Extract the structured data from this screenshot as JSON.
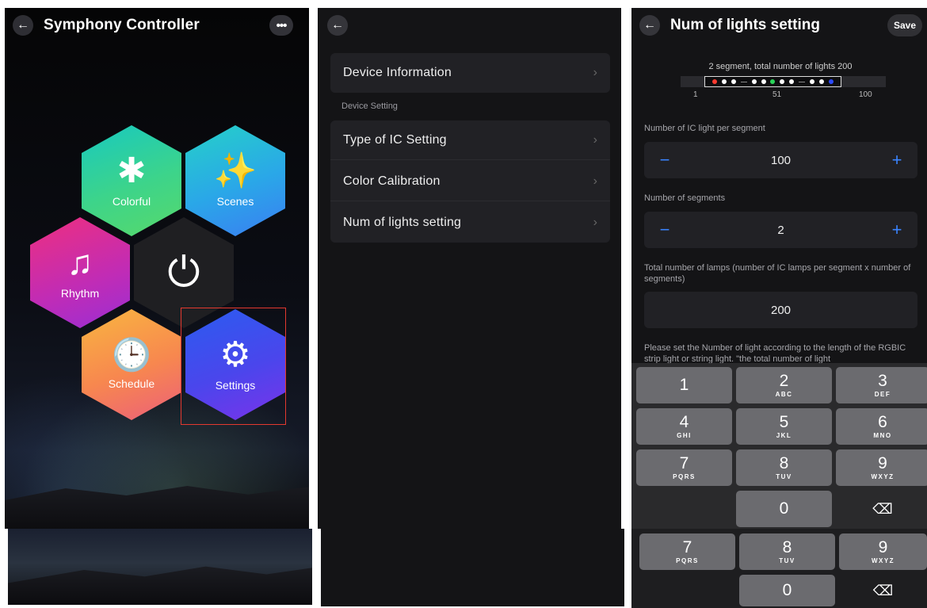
{
  "panel1": {
    "title": "Symphony Controller",
    "back_icon": "←",
    "more_icon": "•••",
    "tiles": {
      "colorful": {
        "label": "Colorful",
        "icon": "✱"
      },
      "scenes": {
        "label": "Scenes",
        "icon": "✨"
      },
      "rhythm": {
        "label": "Rhythm",
        "icon": "♫"
      },
      "power": {
        "icon": "⏻"
      },
      "schedule": {
        "label": "Schedule",
        "icon": "🕒"
      },
      "settings": {
        "label": "Settings",
        "icon": "⚙"
      }
    }
  },
  "panel2": {
    "back_icon": "←",
    "device_information": "Device Information",
    "section_label": "Device Setting",
    "items": [
      "Type of IC Setting",
      "Color Calibration",
      "Num of lights setting"
    ],
    "chevron": "›"
  },
  "panel3": {
    "back_icon": "←",
    "title": "Num of lights setting",
    "save": "Save",
    "segment_caption": "2 segment,  total number of lights 200",
    "ticks": [
      "1",
      "51",
      "100"
    ],
    "ic_per_segment_label": "Number of IC light per segment",
    "ic_per_segment_value": "100",
    "segments_label": "Number of segments",
    "segments_value": "2",
    "total_label": "Total number of lamps (number of IC lamps per segment x number of segments)",
    "total_value": "200",
    "hint": "Please set the Number of light according to the length of the RGBIC strip light or string light. \"the total number of light",
    "minus": "−",
    "plus": "+"
  },
  "keypad": {
    "keys": [
      {
        "n": "1",
        "s": ""
      },
      {
        "n": "2",
        "s": "ABC"
      },
      {
        "n": "3",
        "s": "DEF"
      },
      {
        "n": "4",
        "s": "GHI"
      },
      {
        "n": "5",
        "s": "JKL"
      },
      {
        "n": "6",
        "s": "MNO"
      },
      {
        "n": "7",
        "s": "PQRS"
      },
      {
        "n": "8",
        "s": "TUV"
      },
      {
        "n": "9",
        "s": "WXYZ"
      }
    ],
    "zero": "0",
    "delete_icon": "⌫"
  },
  "colors": {
    "accent": "#3a84ff",
    "highlight": "#e4392f"
  }
}
